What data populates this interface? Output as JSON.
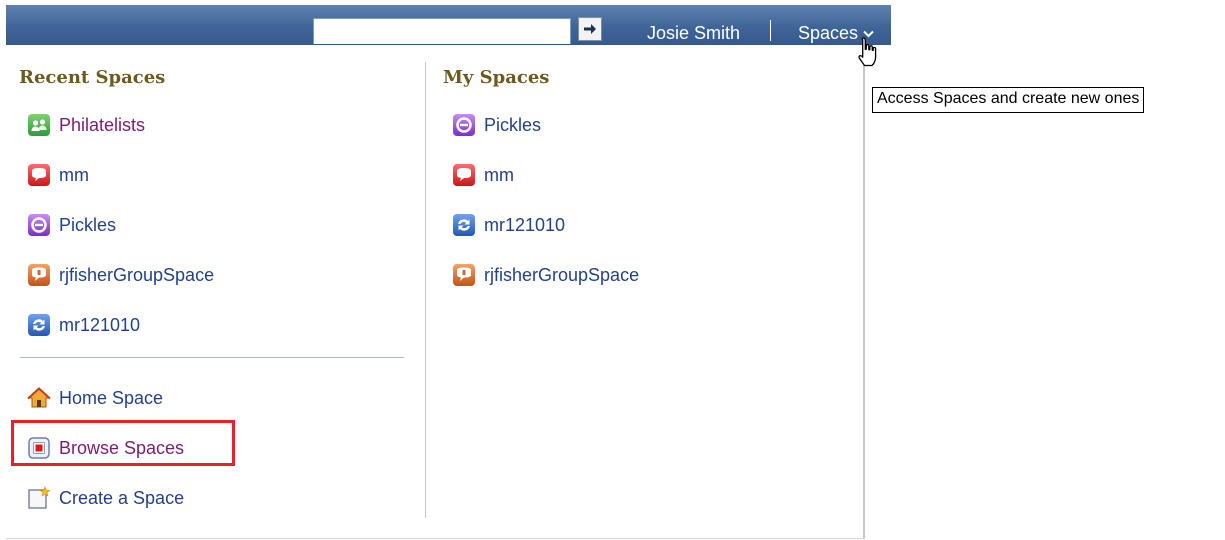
{
  "topbar": {
    "search_value": "",
    "user_name": "Josie Smith",
    "spaces_label": "Spaces",
    "colors": {
      "bar": "#3f6598",
      "text": "#ffffff"
    }
  },
  "recent_spaces": {
    "heading": "Recent Spaces",
    "items": [
      {
        "label": "Philatelists",
        "icon": "people-group-icon"
      },
      {
        "label": "mm",
        "icon": "speech-bubble-icon"
      },
      {
        "label": "Pickles",
        "icon": "pickles-space-icon"
      },
      {
        "label": "rjfisherGroupSpace",
        "icon": "orange-speech-icon"
      },
      {
        "label": "mr121010",
        "icon": "sync-arrows-icon"
      }
    ],
    "actions": [
      {
        "label": "Home Space",
        "icon": "home-icon"
      },
      {
        "label": "Browse Spaces",
        "icon": "browse-spaces-icon"
      },
      {
        "label": "Create a Space",
        "icon": "create-space-icon"
      }
    ]
  },
  "my_spaces": {
    "heading": "My Spaces",
    "items": [
      {
        "label": "Pickles",
        "icon": "pickles-space-icon"
      },
      {
        "label": "mm",
        "icon": "speech-bubble-icon"
      },
      {
        "label": "mr121010",
        "icon": "sync-arrows-icon"
      },
      {
        "label": "rjfisherGroupSpace",
        "icon": "orange-speech-icon"
      }
    ]
  },
  "tooltip": {
    "text": "Access Spaces and create new ones"
  },
  "colors": {
    "heading": "#6d5a1d",
    "link": "#24418b",
    "visited_link": "#7a1e6f",
    "highlight": "#e8202a"
  }
}
